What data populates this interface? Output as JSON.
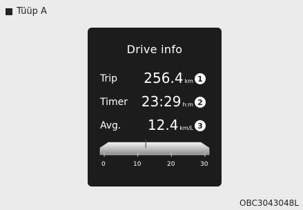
{
  "tag": {
    "label": "Tüüp A"
  },
  "display": {
    "title": "Drive info",
    "rows": [
      {
        "label": "Trip",
        "value": "256.4",
        "unit": "km",
        "marker": "1"
      },
      {
        "label": "Timer",
        "value": "23:29",
        "unit": "h:m",
        "marker": "2"
      },
      {
        "label": "Avg.",
        "value": "12.4",
        "unit": "km/L",
        "marker": "3"
      }
    ],
    "gauge": {
      "ticks": [
        "0",
        "10",
        "20",
        "30"
      ],
      "level": 12.4,
      "scale_min": 0,
      "scale_max": 30
    }
  },
  "footer": {
    "code": "OBC3043048L"
  },
  "colors": {
    "screen_bg": "#1c1c1c",
    "page_bg": "#ebebeb"
  }
}
